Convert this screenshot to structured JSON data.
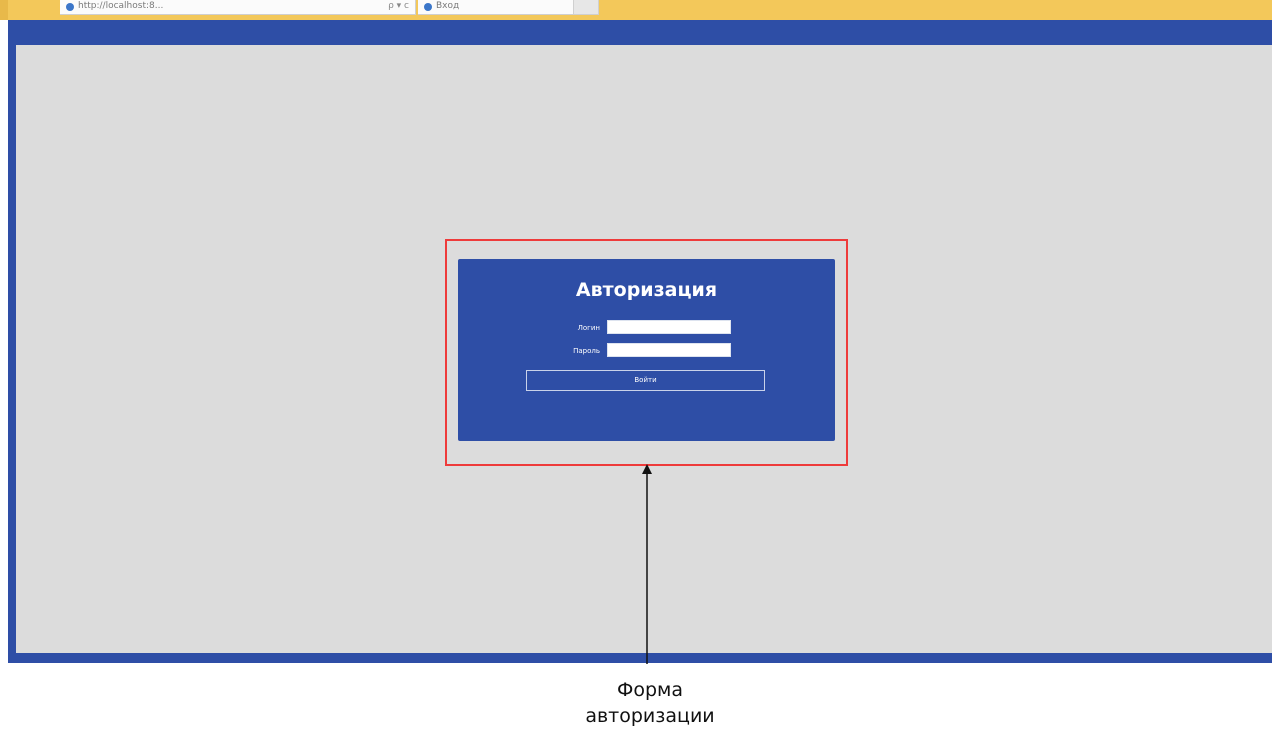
{
  "browser": {
    "address_text": "http://localhost:8...",
    "address_controls": "ρ ▾ c",
    "tab_label": "Вход",
    "new_tab_label": ""
  },
  "login_form": {
    "title": "Авторизация",
    "login_label": "Логин",
    "login_value": "",
    "password_label": "Пароль",
    "password_value": "",
    "submit_label": "Войти"
  },
  "annotation": {
    "caption_line1": "Форма",
    "caption_line2": "авторизации"
  },
  "colors": {
    "app_blue": "#2e4ea6",
    "canvas_gray": "#dcdcdc",
    "highlight_red": "#ee3b3b",
    "chrome_yellow": "#f3c85a"
  }
}
